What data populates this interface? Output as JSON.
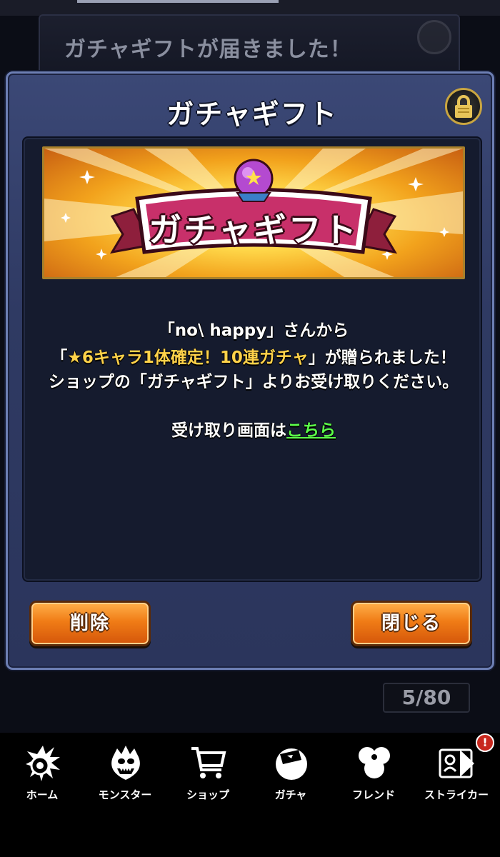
{
  "background": {
    "notification_title": "ガチャギフトが届きました！"
  },
  "modal": {
    "title": "ガチャギフト",
    "banner_text": "ガチャギフト",
    "message": {
      "line1": "「no\\ happy」さんから",
      "line2_open": "「",
      "line2_highlight": "★6キャラ1体確定！10連ガチャ",
      "line2_close": "」が贈られました！",
      "line3": "ショップの「ガチャギフト」よりお受け取りください。",
      "receive_prefix": "受け取り画面は",
      "receive_link": "こちら"
    },
    "buttons": {
      "delete": "削除",
      "close": "閉じる"
    }
  },
  "counter": "5/80",
  "nav": {
    "items": [
      {
        "label": "ホーム",
        "icon": "home-icon"
      },
      {
        "label": "モンスター",
        "icon": "monster-icon"
      },
      {
        "label": "ショップ",
        "icon": "cart-icon"
      },
      {
        "label": "ガチャ",
        "icon": "gacha-icon"
      },
      {
        "label": "フレンド",
        "icon": "friend-icon"
      },
      {
        "label": "ストライカー",
        "icon": "striker-icon"
      }
    ],
    "alert_badge": "!"
  },
  "colors": {
    "modal_bg": "#3b4876",
    "content_bg": "#151b2e",
    "button_orange": "#f07c16",
    "highlight_yellow": "#ffd24a",
    "link_green": "#5cff4a"
  }
}
